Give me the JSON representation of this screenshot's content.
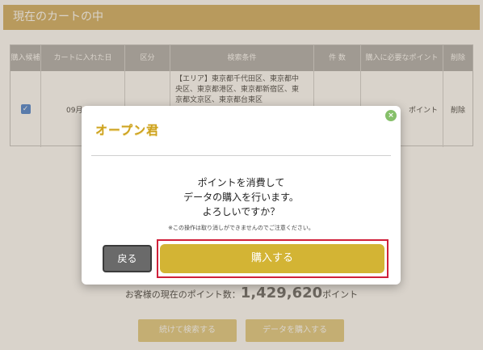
{
  "cart": {
    "header_title": "現在のカートの中",
    "columns": [
      "購入候補",
      "カートに入れた日",
      "区分",
      "検索条件",
      "件 数",
      "購入に必要なポイント",
      "削除"
    ],
    "row": {
      "date": "09月08日",
      "conditions": [
        "【エリア】東京都千代田区、東京都中",
        "央区、東京都港区、東京都新宿区、東",
        "京都文京区、東京都台東区"
      ],
      "points_label": "ポイント",
      "delete": "削除"
    }
  },
  "current_points": {
    "label": "お客様の現在のポイント数：",
    "value": "1,429,620",
    "unit": "ポイント"
  },
  "bg_buttons": {
    "continue_search": "続けて検索する",
    "buy_data": "データを購入する"
  },
  "modal": {
    "title": "オープン君",
    "close_symbol": "×",
    "message_line1": "ポイントを消費して",
    "message_line2": "データの購入を行います。",
    "message_line3": "よろしいですか？",
    "note": "※この操作は取り消しができませんのでご注意ください。",
    "back_label": "戻る",
    "buy_label": "購入する"
  },
  "colors": {
    "accent_gold": "#d3b434",
    "title_gold": "#cda21f",
    "highlight_red": "#d0203a",
    "close_green": "#86c06a"
  }
}
